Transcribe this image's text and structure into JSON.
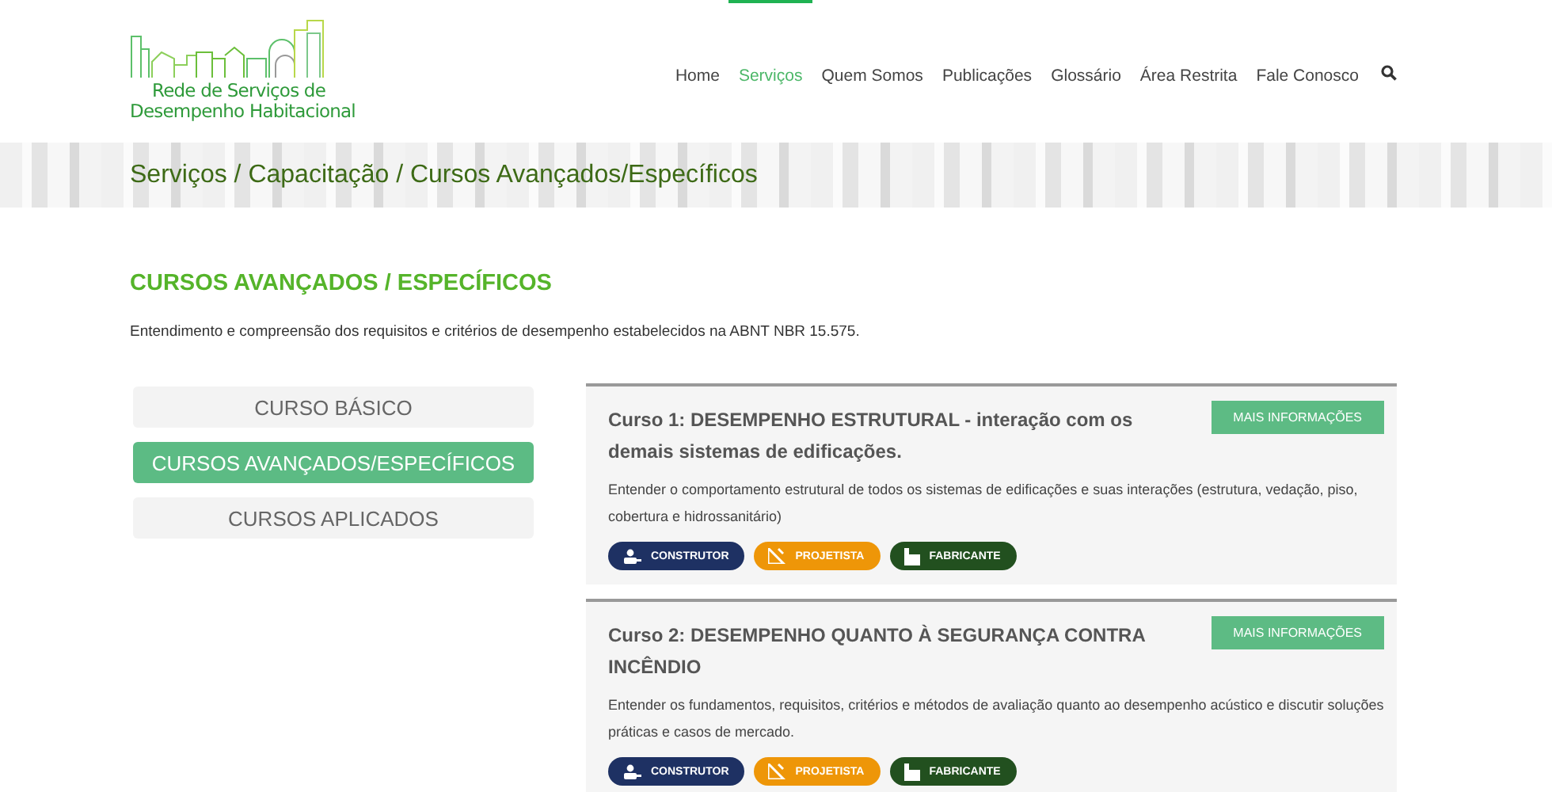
{
  "logo": {
    "line1": "Rede de Serviços de",
    "line2": "Desempenho Habitacional"
  },
  "nav": [
    {
      "label": "Home",
      "selected": false
    },
    {
      "label": "Serviços",
      "selected": true
    },
    {
      "label": "Quem Somos",
      "selected": false
    },
    {
      "label": "Publicações",
      "selected": false
    },
    {
      "label": "Glossário",
      "selected": false
    },
    {
      "label": "Área Restrita",
      "selected": false
    },
    {
      "label": "Fale Conosco",
      "selected": false
    }
  ],
  "breadcrumb": "Serviços / Capacitação / Cursos Avançados/Específicos",
  "heading": "CURSOS AVANÇADOS / ESPECÍFICOS",
  "intro": "Entendimento e compreensão dos requisitos e critérios de desempenho estabelecidos na ABNT NBR 15.575.",
  "categories": [
    {
      "label": "CURSO BÁSICO",
      "selected": false
    },
    {
      "label": "CURSOS AVANÇADOS/ESPECÍFICOS",
      "selected": true
    },
    {
      "label": "CURSOS APLICADOS",
      "selected": false
    }
  ],
  "courses": [
    {
      "title": "Curso 1: DESEMPENHO ESTRUTURAL - interação com os demais sistemas de edificações.",
      "button": "MAIS INFORMAÇÕES",
      "description": "Entender o comportamento estrutural de todos os sistemas de edificações e suas interações (estrutura, vedação, piso, cobertura e hidrossanitário)",
      "tags": [
        {
          "kind": "builder",
          "label": "CONSTRUTOR",
          "color": "#1e3163"
        },
        {
          "kind": "designer",
          "label": "PROJETISTA",
          "color": "#ee9608"
        },
        {
          "kind": "factory",
          "label": "FABRICANTE",
          "color": "#22501f"
        }
      ]
    },
    {
      "title": "Curso 2: DESEMPENHO QUANTO À SEGURANÇA CONTRA INCÊNDIO",
      "button": "MAIS INFORMAÇÕES",
      "description": "Entender os fundamentos, requisitos, critérios e métodos de avaliação quanto ao desempenho acústico e discutir soluções práticas e casos de mercado.",
      "tags": [
        {
          "kind": "builder",
          "label": "CONSTRUTOR",
          "color": "#1e3163"
        },
        {
          "kind": "designer",
          "label": "PROJETISTA",
          "color": "#ee9608"
        },
        {
          "kind": "factory",
          "label": "FABRICANTE",
          "color": "#22501f"
        }
      ]
    }
  ]
}
